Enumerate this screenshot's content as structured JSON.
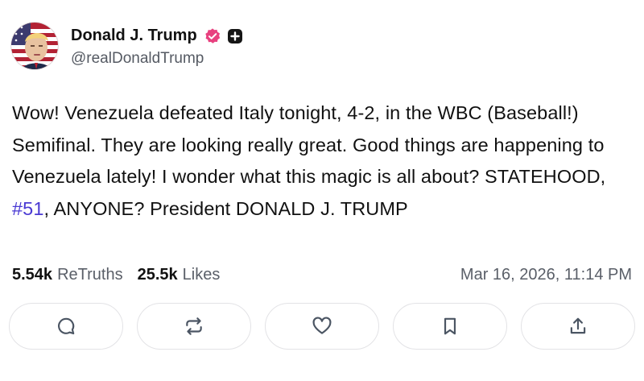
{
  "author": {
    "display_name": "Donald J. Trump",
    "handle": "@realDonaldTrump",
    "verified_badge_color": "#e8417f"
  },
  "post": {
    "text_before_hashtag": "Wow! Venezuela defeated Italy tonight, 4-2, in the WBC (Baseball!) Semifinal. They are looking really great. Good things are happening to Venezuela lately! I wonder what this magic is all about? STATEHOOD, ",
    "hashtag": "#51",
    "text_after_hashtag": ", ANYONE? President DONALD J. TRUMP",
    "hashtag_color": "#4a3ad3"
  },
  "stats": {
    "retruths_count": "5.54k",
    "retruths_label": "ReTruths",
    "likes_count": "25.5k",
    "likes_label": "Likes",
    "timestamp": "Mar 16, 2026, 11:14 PM"
  },
  "actions": [
    {
      "name": "reply",
      "icon": "comment-icon"
    },
    {
      "name": "retruth",
      "icon": "repost-icon"
    },
    {
      "name": "like",
      "icon": "heart-icon"
    },
    {
      "name": "bookmark",
      "icon": "bookmark-icon"
    },
    {
      "name": "share",
      "icon": "share-icon"
    }
  ]
}
